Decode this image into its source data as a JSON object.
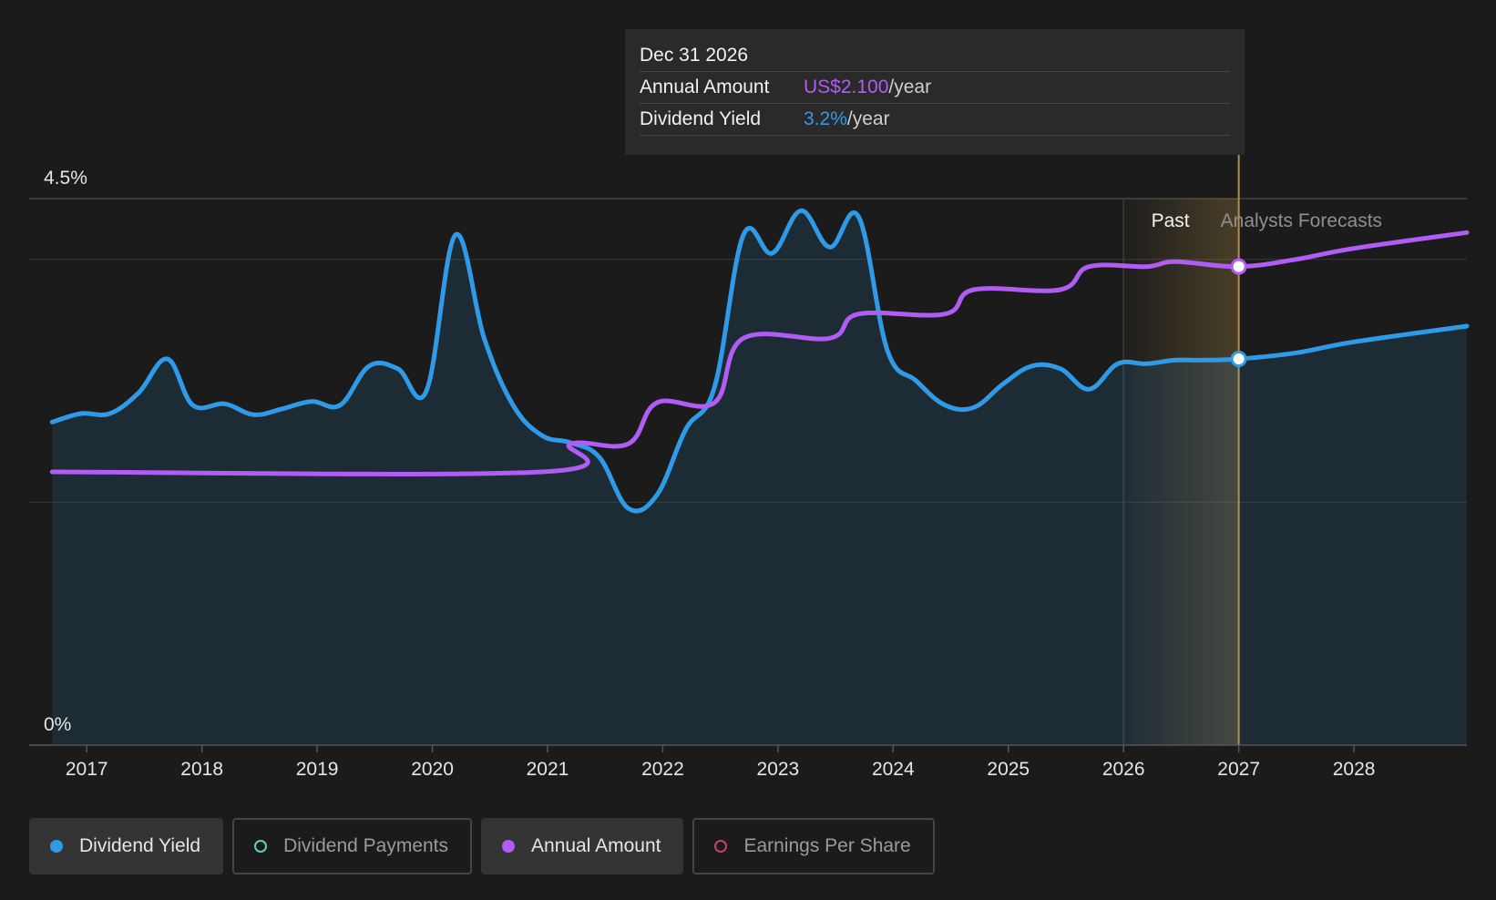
{
  "tooltip": {
    "date": "Dec 31 2026",
    "amount_label": "Annual Amount",
    "amount_value": "US$2.100",
    "yield_label": "Dividend Yield",
    "yield_value": "3.2%",
    "unit": "/year"
  },
  "legend": [
    {
      "label": "Dividend Yield",
      "color": "#2f9be8",
      "active": true,
      "filled": true
    },
    {
      "label": "Dividend Payments",
      "color": "#5fd0c0",
      "active": false,
      "filled": false
    },
    {
      "label": "Annual Amount",
      "color": "#b05cf5",
      "active": true,
      "filled": true
    },
    {
      "label": "Earnings Per Share",
      "color": "#c2407a",
      "active": false,
      "filled": false
    }
  ],
  "colors": {
    "yield": "#2f9be8",
    "amount": "#b05cf5",
    "background": "#1b1b1b",
    "forecast_band": "#c9a050"
  },
  "chart_data": {
    "type": "line",
    "x_axis": {
      "min": 2016.5,
      "max": 2028.98,
      "ticks": [
        "2017",
        "2018",
        "2019",
        "2020",
        "2021",
        "2022",
        "2023",
        "2024",
        "2025",
        "2026",
        "2027",
        "2028"
      ]
    },
    "y_axis": {
      "min": 0,
      "max": 4.5,
      "tick_labels": [
        "0%",
        "4.5%"
      ],
      "gridlines": [
        2.0,
        4.0
      ]
    },
    "grid": true,
    "regions": {
      "past_label": "Past",
      "forecast_label": "Analysts Forecasts",
      "past_start": 2026.0,
      "divider": 2027.0
    },
    "highlight": {
      "x": 2027.0,
      "date": "Dec 31 2026"
    },
    "series": [
      {
        "name": "Dividend Yield",
        "unit": "%",
        "area": true,
        "points": [
          [
            2016.7,
            2.66
          ],
          [
            2016.95,
            2.73
          ],
          [
            2017.2,
            2.73
          ],
          [
            2017.45,
            2.9
          ],
          [
            2017.7,
            3.18
          ],
          [
            2017.92,
            2.8
          ],
          [
            2018.2,
            2.81
          ],
          [
            2018.45,
            2.72
          ],
          [
            2018.7,
            2.77
          ],
          [
            2018.95,
            2.83
          ],
          [
            2019.2,
            2.8
          ],
          [
            2019.45,
            3.12
          ],
          [
            2019.7,
            3.1
          ],
          [
            2019.95,
            2.92
          ],
          [
            2020.2,
            4.2
          ],
          [
            2020.45,
            3.35
          ],
          [
            2020.7,
            2.8
          ],
          [
            2020.95,
            2.55
          ],
          [
            2021.2,
            2.49
          ],
          [
            2021.45,
            2.37
          ],
          [
            2021.7,
            1.95
          ],
          [
            2021.95,
            2.06
          ],
          [
            2022.2,
            2.6
          ],
          [
            2022.45,
            2.95
          ],
          [
            2022.7,
            4.2
          ],
          [
            2022.95,
            4.05
          ],
          [
            2023.2,
            4.4
          ],
          [
            2023.45,
            4.1
          ],
          [
            2023.7,
            4.35
          ],
          [
            2023.95,
            3.25
          ],
          [
            2024.2,
            3.0
          ],
          [
            2024.45,
            2.8
          ],
          [
            2024.7,
            2.78
          ],
          [
            2024.95,
            2.97
          ],
          [
            2025.2,
            3.12
          ],
          [
            2025.45,
            3.1
          ],
          [
            2025.7,
            2.93
          ],
          [
            2025.95,
            3.14
          ],
          [
            2026.2,
            3.14
          ],
          [
            2026.45,
            3.17
          ],
          [
            2026.7,
            3.17
          ],
          [
            2027.0,
            3.18
          ],
          [
            2027.5,
            3.23
          ],
          [
            2028.0,
            3.32
          ],
          [
            2028.98,
            3.45
          ]
        ]
      },
      {
        "name": "Annual Amount",
        "unit": "US$",
        "area": false,
        "points": [
          [
            2016.7,
            2.25
          ],
          [
            2020.95,
            2.25
          ],
          [
            2021.2,
            2.48
          ],
          [
            2021.7,
            2.48
          ],
          [
            2021.95,
            2.82
          ],
          [
            2022.45,
            2.82
          ],
          [
            2022.7,
            3.35
          ],
          [
            2023.45,
            3.35
          ],
          [
            2023.7,
            3.55
          ],
          [
            2024.45,
            3.55
          ],
          [
            2024.7,
            3.75
          ],
          [
            2025.45,
            3.75
          ],
          [
            2025.7,
            3.94
          ],
          [
            2026.2,
            3.94
          ],
          [
            2026.45,
            3.98
          ],
          [
            2027.0,
            3.94
          ],
          [
            2027.5,
            4.0
          ],
          [
            2028.0,
            4.09
          ],
          [
            2028.98,
            4.22
          ]
        ]
      }
    ]
  }
}
